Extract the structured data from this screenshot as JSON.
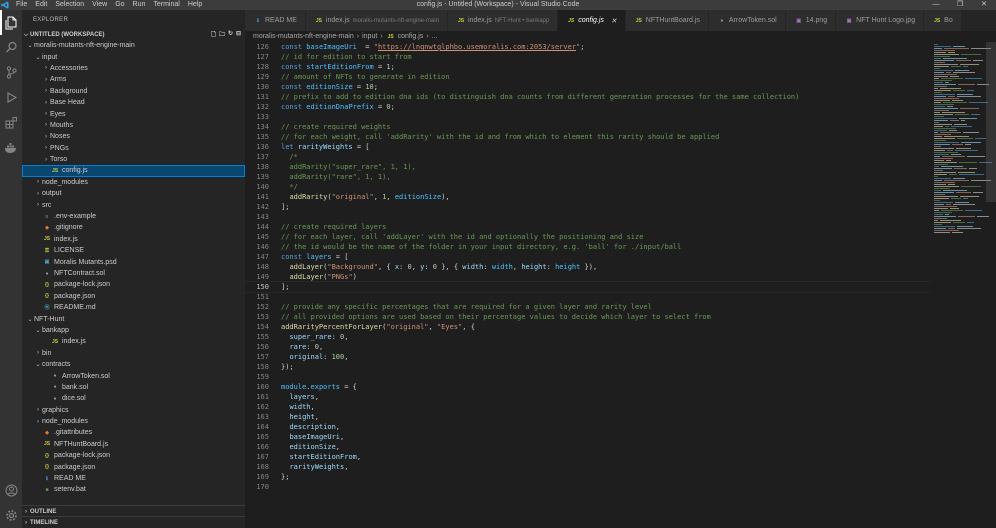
{
  "window": {
    "title": "config.js - Untitled (Workspace) - Visual Studio Code",
    "menu": [
      "File",
      "Edit",
      "Selection",
      "View",
      "Go",
      "Run",
      "Terminal",
      "Help"
    ]
  },
  "explorer": {
    "header": "EXPLORER",
    "workspace": "UNTITLED (WORKSPACE)",
    "items": [
      {
        "label": "moralis-mutants-nft-engine-main",
        "depth": 0,
        "kind": "folder-open"
      },
      {
        "label": "input",
        "depth": 1,
        "kind": "folder-open"
      },
      {
        "label": "Accessories",
        "depth": 2,
        "kind": "folder"
      },
      {
        "label": "Arms",
        "depth": 2,
        "kind": "folder"
      },
      {
        "label": "Background",
        "depth": 2,
        "kind": "folder"
      },
      {
        "label": "Base Head",
        "depth": 2,
        "kind": "folder"
      },
      {
        "label": "Eyes",
        "depth": 2,
        "kind": "folder"
      },
      {
        "label": "Mouths",
        "depth": 2,
        "kind": "folder"
      },
      {
        "label": "Noses",
        "depth": 2,
        "kind": "folder"
      },
      {
        "label": "PNGs",
        "depth": 2,
        "kind": "folder"
      },
      {
        "label": "Torso",
        "depth": 2,
        "kind": "folder"
      },
      {
        "label": "config.js",
        "depth": 2,
        "kind": "js",
        "selected": true
      },
      {
        "label": "node_modules",
        "depth": 1,
        "kind": "folder"
      },
      {
        "label": "output",
        "depth": 1,
        "kind": "folder"
      },
      {
        "label": "src",
        "depth": 1,
        "kind": "folder"
      },
      {
        "label": ".env-example",
        "depth": 1,
        "kind": "env"
      },
      {
        "label": ".gitignore",
        "depth": 1,
        "kind": "git"
      },
      {
        "label": "index.js",
        "depth": 1,
        "kind": "js"
      },
      {
        "label": "LICENSE",
        "depth": 1,
        "kind": "license"
      },
      {
        "label": "Moralis Mutants.psd",
        "depth": 1,
        "kind": "psd"
      },
      {
        "label": "NFTContract.sol",
        "depth": 1,
        "kind": "sol"
      },
      {
        "label": "package-lock.json",
        "depth": 1,
        "kind": "json"
      },
      {
        "label": "package.json",
        "depth": 1,
        "kind": "json"
      },
      {
        "label": "README.md",
        "depth": 1,
        "kind": "md"
      },
      {
        "label": "NFT-Hunt",
        "depth": 0,
        "kind": "folder-open"
      },
      {
        "label": "bankapp",
        "depth": 1,
        "kind": "folder-open"
      },
      {
        "label": "index.js",
        "depth": 2,
        "kind": "js"
      },
      {
        "label": "bin",
        "depth": 1,
        "kind": "folder"
      },
      {
        "label": "contracts",
        "depth": 1,
        "kind": "folder-open"
      },
      {
        "label": "ArrowToken.sol",
        "depth": 2,
        "kind": "sol"
      },
      {
        "label": "bank.sol",
        "depth": 2,
        "kind": "sol"
      },
      {
        "label": "dice.sol",
        "depth": 2,
        "kind": "sol"
      },
      {
        "label": "graphics",
        "depth": 1,
        "kind": "folder"
      },
      {
        "label": "node_modules",
        "depth": 1,
        "kind": "folder"
      },
      {
        "label": ".gitattributes",
        "depth": 1,
        "kind": "git"
      },
      {
        "label": "NFTHuntBoard.js",
        "depth": 1,
        "kind": "js"
      },
      {
        "label": "package-lock.json",
        "depth": 1,
        "kind": "json"
      },
      {
        "label": "package.json",
        "depth": 1,
        "kind": "json"
      },
      {
        "label": "READ ME",
        "depth": 1,
        "kind": "readme"
      },
      {
        "label": "setenv.bat",
        "depth": 1,
        "kind": "bat"
      }
    ],
    "outline": "OUTLINE",
    "timeline": "TIMELINE"
  },
  "tabs": [
    {
      "label": "READ ME",
      "desc": "",
      "icon": "readme"
    },
    {
      "label": "index.js",
      "desc": "moralis-mutants-nft-engine-main",
      "icon": "js"
    },
    {
      "label": "index.js",
      "desc": "NFT-Hunt • bankapp",
      "icon": "js"
    },
    {
      "label": "config.js",
      "desc": "",
      "icon": "js",
      "active": true
    },
    {
      "label": "NFTHuntBoard.js",
      "desc": "",
      "icon": "js"
    },
    {
      "label": "ArrowToken.sol",
      "desc": "",
      "icon": "sol"
    },
    {
      "label": "14.png",
      "desc": "",
      "icon": "img"
    },
    {
      "label": "NFT Hunt Logo.jpg",
      "desc": "",
      "icon": "img"
    },
    {
      "label": "Bo",
      "desc": "",
      "icon": "js"
    }
  ],
  "breadcrumb": [
    "moralis-mutants-nft-engine-main",
    "input",
    "config.js",
    "..."
  ],
  "colors": {
    "accent": "#007acc",
    "selection": "#094771",
    "keyword": "#569cd6",
    "string": "#ce9178",
    "comment": "#6a9955",
    "number": "#b5cea8",
    "function": "#dcdcaa",
    "constant": "#4fc1ff",
    "variable": "#9cdcfe"
  },
  "editor": {
    "current_line": 150,
    "lines": [
      {
        "n": 126,
        "t": [
          [
            "kw",
            "const "
          ],
          [
            "cn",
            "baseImageUri"
          ],
          [
            "",
            "  = "
          ],
          [
            "str",
            "\""
          ],
          [
            "url",
            "https://lnqnwtglphbo.usemoralis.com:2053/server"
          ],
          [
            "str",
            "\""
          ],
          [
            "",
            ";"
          ]
        ]
      },
      {
        "n": 127,
        "t": [
          [
            "cm",
            "// id for edition to start from"
          ]
        ]
      },
      {
        "n": 128,
        "t": [
          [
            "kw",
            "const "
          ],
          [
            "cn",
            "startEditionFrom"
          ],
          [
            "",
            " = "
          ],
          [
            "num",
            "1"
          ],
          [
            "",
            ";"
          ]
        ]
      },
      {
        "n": 129,
        "t": [
          [
            "cm",
            "// amount of NFTs to generate in edition"
          ]
        ]
      },
      {
        "n": 130,
        "t": [
          [
            "kw",
            "const "
          ],
          [
            "cn",
            "editionSize"
          ],
          [
            "",
            " = "
          ],
          [
            "num",
            "10"
          ],
          [
            "",
            ";"
          ]
        ]
      },
      {
        "n": 131,
        "t": [
          [
            "cm",
            "// prefix to add to edition dna ids (to distinguish dna counts from different generation processes for the same collection)"
          ]
        ]
      },
      {
        "n": 132,
        "t": [
          [
            "kw",
            "const "
          ],
          [
            "cn",
            "editionDnaPrefix"
          ],
          [
            "",
            " = "
          ],
          [
            "num",
            "0"
          ],
          [
            "",
            ";"
          ]
        ]
      },
      {
        "n": 133,
        "t": []
      },
      {
        "n": 134,
        "t": [
          [
            "cm",
            "// create required weights"
          ]
        ]
      },
      {
        "n": 135,
        "t": [
          [
            "cm",
            "// for each weight, call 'addRarity' with the id and from which to element this rarity should be applied"
          ]
        ]
      },
      {
        "n": 136,
        "t": [
          [
            "kw",
            "let "
          ],
          [
            "var",
            "rarityWeights"
          ],
          [
            "",
            " = ["
          ]
        ]
      },
      {
        "n": 137,
        "t": [
          [
            "cm",
            "  /*"
          ]
        ]
      },
      {
        "n": 138,
        "t": [
          [
            "cm",
            "  addRarity(\"super_rare\", 1, 1),"
          ]
        ]
      },
      {
        "n": 139,
        "t": [
          [
            "cm",
            "  addRarity(\"rare\", 1, 1),"
          ]
        ]
      },
      {
        "n": 140,
        "t": [
          [
            "cm",
            "  */"
          ]
        ]
      },
      {
        "n": 141,
        "t": [
          [
            "",
            "  "
          ],
          [
            "fn",
            "addRarity"
          ],
          [
            "",
            "("
          ],
          [
            "str",
            "\"original\""
          ],
          [
            "",
            ", "
          ],
          [
            "num",
            "1"
          ],
          [
            "",
            ", "
          ],
          [
            "cn",
            "editionSize"
          ],
          [
            "",
            "),"
          ]
        ]
      },
      {
        "n": 142,
        "t": [
          [
            "",
            "];"
          ]
        ]
      },
      {
        "n": 143,
        "t": []
      },
      {
        "n": 144,
        "t": [
          [
            "cm",
            "// create required layers"
          ]
        ]
      },
      {
        "n": 145,
        "t": [
          [
            "cm",
            "// for each layer, call 'addLayer' with the id and optionally the positioning and size"
          ]
        ]
      },
      {
        "n": 146,
        "t": [
          [
            "cm",
            "// the id would be the name of the folder in your input directory, e.g. 'ball' for ./input/ball"
          ]
        ]
      },
      {
        "n": 147,
        "t": [
          [
            "kw",
            "const "
          ],
          [
            "cn",
            "layers"
          ],
          [
            "",
            " = ["
          ]
        ]
      },
      {
        "n": 148,
        "t": [
          [
            "",
            "  "
          ],
          [
            "fn",
            "addLayer"
          ],
          [
            "",
            "("
          ],
          [
            "str",
            "\"Background\""
          ],
          [
            "",
            ", { "
          ],
          [
            "var",
            "x"
          ],
          [
            "",
            ": "
          ],
          [
            "num",
            "0"
          ],
          [
            "",
            ", "
          ],
          [
            "var",
            "y"
          ],
          [
            "",
            ": "
          ],
          [
            "num",
            "0"
          ],
          [
            "",
            " }, { "
          ],
          [
            "var",
            "width"
          ],
          [
            "",
            ": "
          ],
          [
            "cn",
            "width"
          ],
          [
            "",
            ", "
          ],
          [
            "var",
            "height"
          ],
          [
            "",
            ": "
          ],
          [
            "cn",
            "height"
          ],
          [
            "",
            " }),"
          ]
        ]
      },
      {
        "n": 149,
        "t": [
          [
            "",
            "  "
          ],
          [
            "fn",
            "addLayer"
          ],
          [
            "",
            "("
          ],
          [
            "str",
            "\"PNGs\""
          ],
          [
            "",
            ")"
          ]
        ]
      },
      {
        "n": 150,
        "t": [
          [
            "",
            "];"
          ]
        ]
      },
      {
        "n": 151,
        "t": []
      },
      {
        "n": 152,
        "t": [
          [
            "cm",
            "// provide any specific percentages that are required for a given layer and rarity level"
          ]
        ]
      },
      {
        "n": 153,
        "t": [
          [
            "cm",
            "// all provided options are used based on their percentage values to decide which layer to select from"
          ]
        ]
      },
      {
        "n": 154,
        "t": [
          [
            "fn",
            "addRarityPercentForLayer"
          ],
          [
            "",
            "("
          ],
          [
            "str",
            "\"original\""
          ],
          [
            "",
            ", "
          ],
          [
            "str",
            "\"Eyes\""
          ],
          [
            "",
            ", {"
          ]
        ]
      },
      {
        "n": 155,
        "t": [
          [
            "",
            "  "
          ],
          [
            "var",
            "super_rare"
          ],
          [
            "",
            ": "
          ],
          [
            "num",
            "0"
          ],
          [
            "",
            ","
          ]
        ]
      },
      {
        "n": 156,
        "t": [
          [
            "",
            "  "
          ],
          [
            "var",
            "rare"
          ],
          [
            "",
            ": "
          ],
          [
            "num",
            "0"
          ],
          [
            "",
            ","
          ]
        ]
      },
      {
        "n": 157,
        "t": [
          [
            "",
            "  "
          ],
          [
            "var",
            "original"
          ],
          [
            "",
            ": "
          ],
          [
            "num",
            "100"
          ],
          [
            "",
            ","
          ]
        ]
      },
      {
        "n": 158,
        "t": [
          [
            "",
            "});"
          ]
        ]
      },
      {
        "n": 159,
        "t": []
      },
      {
        "n": 160,
        "t": [
          [
            "cn",
            "module"
          ],
          [
            "",
            "."
          ],
          [
            "cn",
            "exports"
          ],
          [
            "",
            " = {"
          ]
        ]
      },
      {
        "n": 161,
        "t": [
          [
            "",
            "  "
          ],
          [
            "var",
            "layers"
          ],
          [
            "",
            ","
          ]
        ]
      },
      {
        "n": 162,
        "t": [
          [
            "",
            "  "
          ],
          [
            "var",
            "width"
          ],
          [
            "",
            ","
          ]
        ]
      },
      {
        "n": 163,
        "t": [
          [
            "",
            "  "
          ],
          [
            "var",
            "height"
          ],
          [
            "",
            ","
          ]
        ]
      },
      {
        "n": 164,
        "t": [
          [
            "",
            "  "
          ],
          [
            "var",
            "description"
          ],
          [
            "",
            ","
          ]
        ]
      },
      {
        "n": 165,
        "t": [
          [
            "",
            "  "
          ],
          [
            "var",
            "baseImageUri"
          ],
          [
            "",
            ","
          ]
        ]
      },
      {
        "n": 166,
        "t": [
          [
            "",
            "  "
          ],
          [
            "var",
            "editionSize"
          ],
          [
            "",
            ","
          ]
        ]
      },
      {
        "n": 167,
        "t": [
          [
            "",
            "  "
          ],
          [
            "var",
            "startEditionFrom"
          ],
          [
            "",
            ","
          ]
        ]
      },
      {
        "n": 168,
        "t": [
          [
            "",
            "  "
          ],
          [
            "var",
            "rarityWeights"
          ],
          [
            "",
            ","
          ]
        ]
      },
      {
        "n": 169,
        "t": [
          [
            "",
            "};"
          ]
        ]
      },
      {
        "n": 170,
        "t": []
      }
    ]
  }
}
